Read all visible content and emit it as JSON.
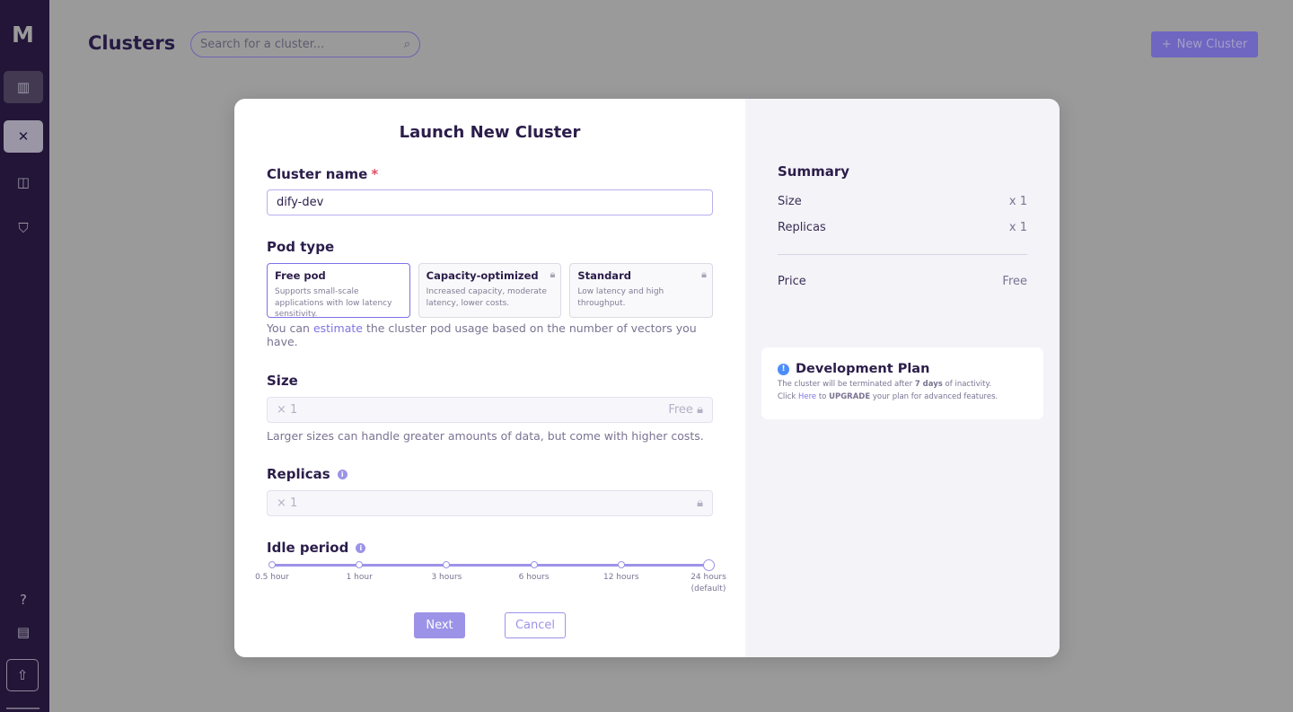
{
  "sidebar": {
    "logo": "M",
    "icons": [
      "building-icon",
      "cluster-network-icon",
      "contact-search-icon",
      "shield-key-icon",
      "help-icon",
      "document-icon",
      "upgrade-icon"
    ]
  },
  "header": {
    "title": "Clusters",
    "search_placeholder": "Search for a cluster...",
    "new_cluster": "New Cluster"
  },
  "modal": {
    "title": "Launch New Cluster",
    "cluster_name": {
      "label": "Cluster name",
      "required": "*",
      "value": "dify-dev"
    },
    "pod_type": {
      "label": "Pod type",
      "options": [
        {
          "name": "Free pod",
          "desc": "Supports small-scale applications with low latency sensitivity.",
          "selected": true,
          "locked": false
        },
        {
          "name": "Capacity-optimized",
          "desc": "Increased capacity, moderate latency, lower costs.",
          "selected": false,
          "locked": true
        },
        {
          "name": "Standard",
          "desc": "Low latency and high throughput.",
          "selected": false,
          "locked": true
        }
      ],
      "hint_pre": "You can ",
      "hint_link": "estimate",
      "hint_post": " the cluster pod usage based on the number of vectors you have."
    },
    "size": {
      "label": "Size",
      "value": "× 1",
      "price": "Free",
      "hint": "Larger sizes can handle greater amounts of data, but come with higher costs."
    },
    "replicas": {
      "label": "Replicas",
      "value": "× 1"
    },
    "idle": {
      "label": "Idle period",
      "ticks": [
        "0.5 hour",
        "1 hour",
        "3 hours",
        "6 hours",
        "12 hours",
        "24 hours"
      ],
      "default_note": "(default)",
      "selected": "24 hours"
    },
    "next": "Next",
    "cancel": "Cancel",
    "summary": {
      "title": "Summary",
      "size_label": "Size",
      "size_value": "x 1",
      "replicas_label": "Replicas",
      "replicas_value": "x 1",
      "price_label": "Price",
      "price_value": "Free"
    },
    "plan": {
      "title": "Development Plan",
      "l1_pre": "The cluster will be terminated after ",
      "l1_bold": "7 days",
      "l1_post": " of inactivity.",
      "l2_pre": "Click ",
      "l2_link": "Here",
      "l2_mid": " to ",
      "l2_bold": "UPGRADE",
      "l2_post": " your plan for advanced features."
    }
  },
  "colors": {
    "accent": "#9c93e8",
    "sidebar": "#221537",
    "info": "#4c8dfb"
  }
}
